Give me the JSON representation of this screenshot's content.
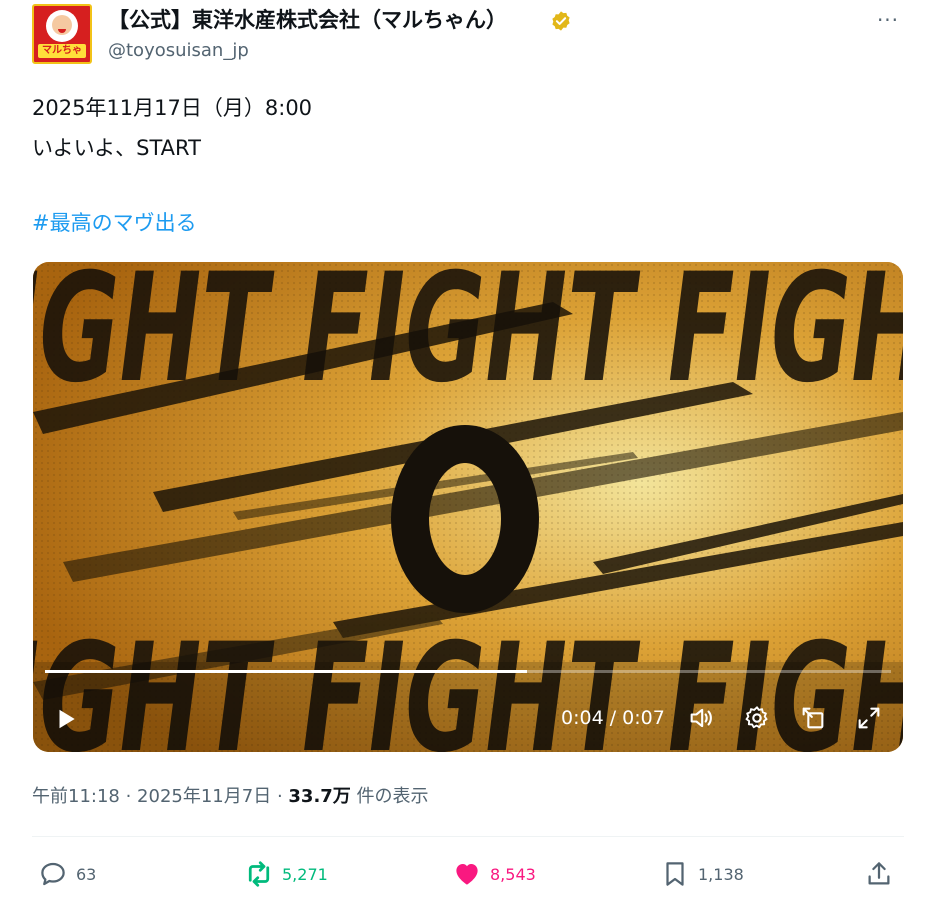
{
  "author": {
    "display_name": "【公式】東洋水産株式会社（マルちゃん）",
    "handle": "@toyosuisan_jp",
    "avatar_label": "マルちゃん",
    "verified": true,
    "verified_color": "#e2b719"
  },
  "post": {
    "lines": [
      "2025年11月17日（月）8:00",
      "いよいよ、START"
    ],
    "hashtag": "#最高のマヴ出る",
    "more_label": "···"
  },
  "video": {
    "current_time": "0:04",
    "duration": "0:07",
    "progress": 0.57,
    "play_icon": "play-icon",
    "controls": [
      "volume-icon",
      "settings-icon",
      "pip-icon",
      "fullscreen-icon"
    ]
  },
  "meta": {
    "time": "午前11:18",
    "separator": " · ",
    "date": "2025年11月7日",
    "views": "33.7万",
    "views_suffix": " 件の表示"
  },
  "actions": {
    "replies": "63",
    "reposts": "5,271",
    "likes": "8,543",
    "bookmarks": "1,138"
  },
  "colors": {
    "link": "#1d9bf0",
    "repost": "#00ba7c",
    "like": "#f91880",
    "muted": "#536471"
  }
}
